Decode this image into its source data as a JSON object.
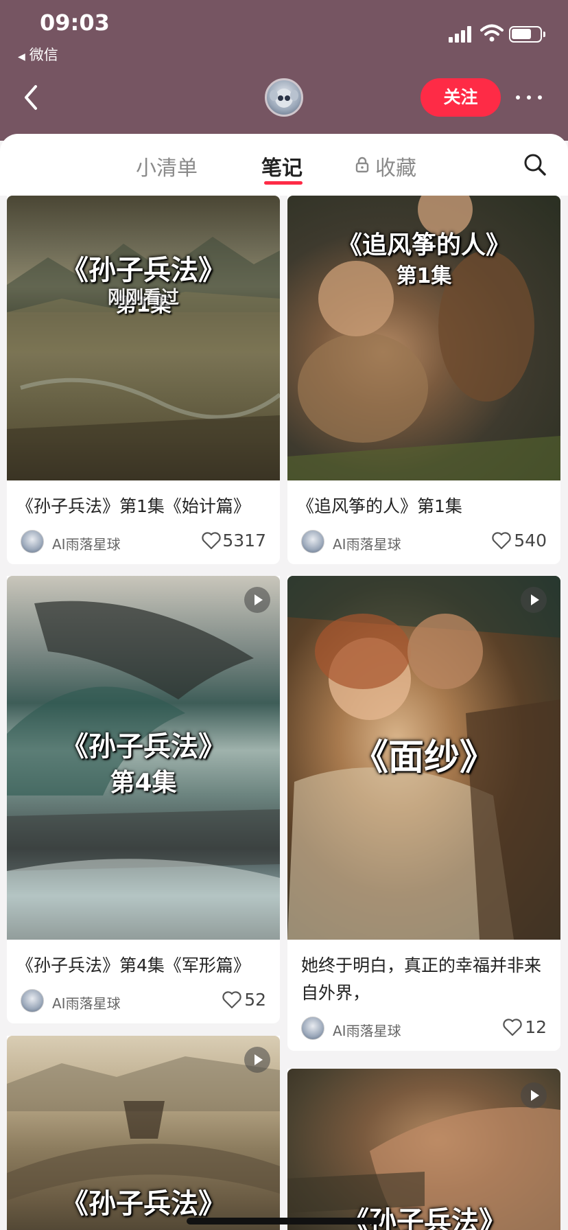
{
  "status_bar": {
    "time": "09:03",
    "back_app": "微信"
  },
  "header": {
    "follow_label": "关注"
  },
  "tabs": [
    {
      "label": "小清单",
      "active": false
    },
    {
      "label": "笔记",
      "active": true
    },
    {
      "label": "收藏",
      "active": false,
      "locked": true
    }
  ],
  "colors": {
    "header_bg": "#765562",
    "accent": "#fe2b46"
  },
  "cards": [
    {
      "cover_title": "《孙子兵法》",
      "cover_sub": "第1集",
      "cover_badge": "刚刚看过",
      "title": "《孙子兵法》第1集《始计篇》",
      "author": "AI雨落星球",
      "likes": "5317",
      "is_video": false
    },
    {
      "cover_title": "《追风筝的人》",
      "cover_sub": "第1集",
      "title": "《追风筝的人》第1集",
      "author": "AI雨落星球",
      "likes": "540",
      "is_video": false
    },
    {
      "cover_title": "《孙子兵法》",
      "cover_sub": "第4集",
      "title": "《孙子兵法》第4集《军形篇》",
      "author": "AI雨落星球",
      "likes": "52",
      "is_video": true
    },
    {
      "cover_title": "《面纱》",
      "title": "她终于明白，真正的幸福并非来自外界，",
      "author": "AI雨落星球",
      "likes": "12",
      "is_video": true
    },
    {
      "cover_title": "《孙子兵法》",
      "is_video": true
    },
    {
      "cover_title": "《孙子兵法》",
      "is_video": true
    }
  ]
}
